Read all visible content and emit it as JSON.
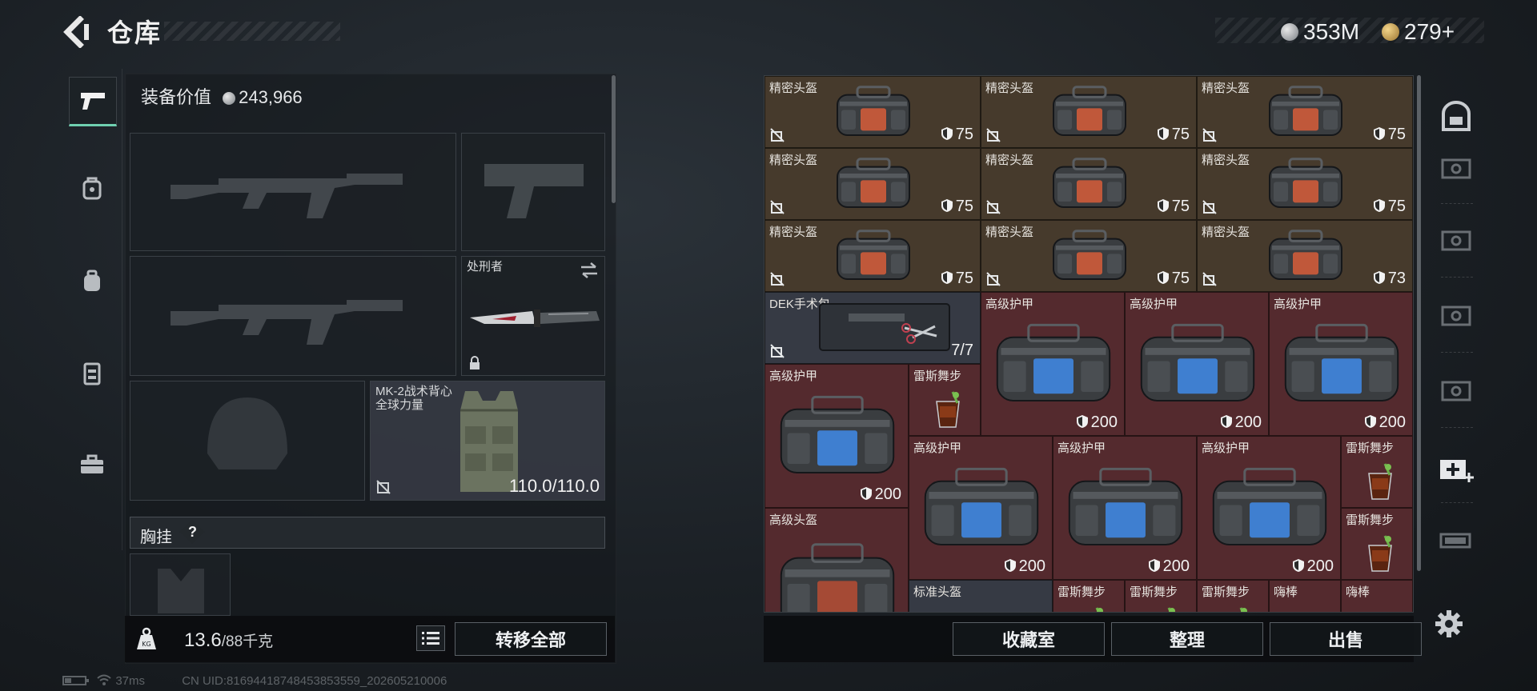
{
  "header": {
    "title": "仓库",
    "currency_silver": "353M",
    "currency_gold": "279+"
  },
  "equipment": {
    "value_label": "装备价值",
    "value": "243,966",
    "melee_name": "处刑者",
    "armor_name": "MK-2战术背心",
    "armor_sub": "全球力量",
    "armor_durability": "110.0/110.0",
    "chest_label": "胸挂",
    "chest_help": "?"
  },
  "footer_left": {
    "weight": "13.6",
    "weight_max": "/88千克",
    "transfer_all": "转移全部"
  },
  "footer_right": {
    "collection": "收藏室",
    "organize": "整理",
    "sell": "出售"
  },
  "status": {
    "ping": "37ms",
    "uid": "CN UID:81694418748453853559_202605210006"
  },
  "grid": {
    "items": [
      {
        "name": "精密头盔",
        "dur": "75"
      },
      {
        "name": "精密头盔",
        "dur": "75"
      },
      {
        "name": "精密头盔",
        "dur": "75"
      },
      {
        "name": "精密头盔",
        "dur": "75"
      },
      {
        "name": "精密头盔",
        "dur": "75"
      },
      {
        "name": "精密头盔",
        "dur": "75"
      },
      {
        "name": "精密头盔",
        "dur": "75"
      },
      {
        "name": "精密头盔",
        "dur": "75"
      },
      {
        "name": "精密头盔",
        "dur": "73"
      },
      {
        "name": "DEK手术包",
        "dur": "7/7"
      },
      {
        "name": "高级护甲",
        "dur": "200"
      },
      {
        "name": "高级护甲",
        "dur": "200"
      },
      {
        "name": "高级护甲",
        "dur": "200"
      },
      {
        "name": "高级护甲",
        "dur": "200"
      },
      {
        "name": "雷斯舞步",
        "dur": ""
      },
      {
        "name": "高级护甲",
        "dur": "200"
      },
      {
        "name": "高级护甲",
        "dur": "200"
      },
      {
        "name": "高级护甲",
        "dur": "200"
      },
      {
        "name": "雷斯舞步",
        "dur": ""
      },
      {
        "name": "高级头盔",
        "dur": ""
      },
      {
        "name": "雷斯舞步",
        "dur": ""
      },
      {
        "name": "标准头盔",
        "dur": ""
      },
      {
        "name": "雷斯舞步",
        "dur": ""
      },
      {
        "name": "雷斯舞步",
        "dur": ""
      },
      {
        "name": "雷斯舞步",
        "dur": ""
      },
      {
        "name": "嗨棒",
        "dur": ""
      },
      {
        "name": "嗨棒",
        "dur": ""
      }
    ]
  },
  "colors": {
    "accent": "#6fd0b0",
    "cell_brown": "#463a2c",
    "cell_red": "#542a2e",
    "cell_grey": "#363a44"
  },
  "icons": [
    "back-arrow-icon",
    "silver-coin-icon",
    "gold-coin-icon",
    "pistol-icon",
    "backpack-icon",
    "bag-icon",
    "vest-icon",
    "toolbox-icon",
    "swap-icon",
    "lock-icon",
    "no-trade-icon",
    "shield-icon",
    "list-icon",
    "weight-icon",
    "gear-icon",
    "safe-icon",
    "case-icon",
    "medkit-plus-icon"
  ]
}
